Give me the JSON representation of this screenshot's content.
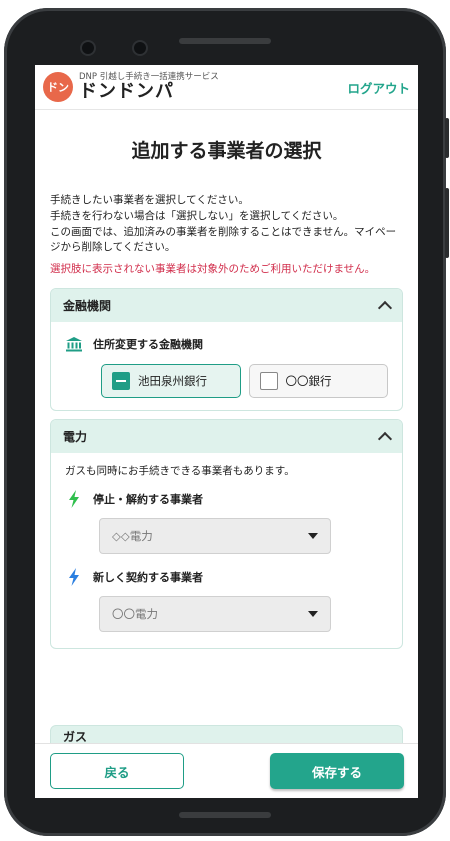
{
  "header": {
    "service_name": "DNP 引越し手続き一括連携サービス",
    "brand": "ドンドンパ",
    "logo_text": "ドン",
    "logout": "ログアウト"
  },
  "page": {
    "title": "追加する事業者の選択",
    "desc_1": "手続きしたい事業者を選択してください。",
    "desc_2": "手続きを行わない場合は「選択しない」を選択してください。",
    "desc_3": "この画面では、追加済みの事業者を削除することはできません。マイページから削除してください。",
    "warning": "選択肢に表示されない事業者は対象外のためご利用いただけません。"
  },
  "sections": {
    "finance": {
      "title": "金融機関",
      "subtitle": "住所変更する金融機関",
      "options": [
        "池田泉州銀行",
        "〇〇銀行"
      ]
    },
    "power": {
      "title": "電力",
      "note": "ガスも同時にお手続きできる事業者もあります。",
      "stop_label": "停止・解約する事業者",
      "stop_value": "◇◇電力",
      "new_label": "新しく契約する事業者",
      "new_value": "〇〇電力"
    },
    "gas": {
      "title": "ガス"
    }
  },
  "footer": {
    "back": "戻る",
    "save": "保存する"
  },
  "colors": {
    "accent": "#23a58c",
    "warning": "#d12d4b",
    "section_bg": "#dff2ec",
    "logo": "#e8684a"
  },
  "icons": [
    "bank-icon",
    "lightning-icon",
    "chevron-up-icon",
    "dropdown-caret-icon"
  ]
}
